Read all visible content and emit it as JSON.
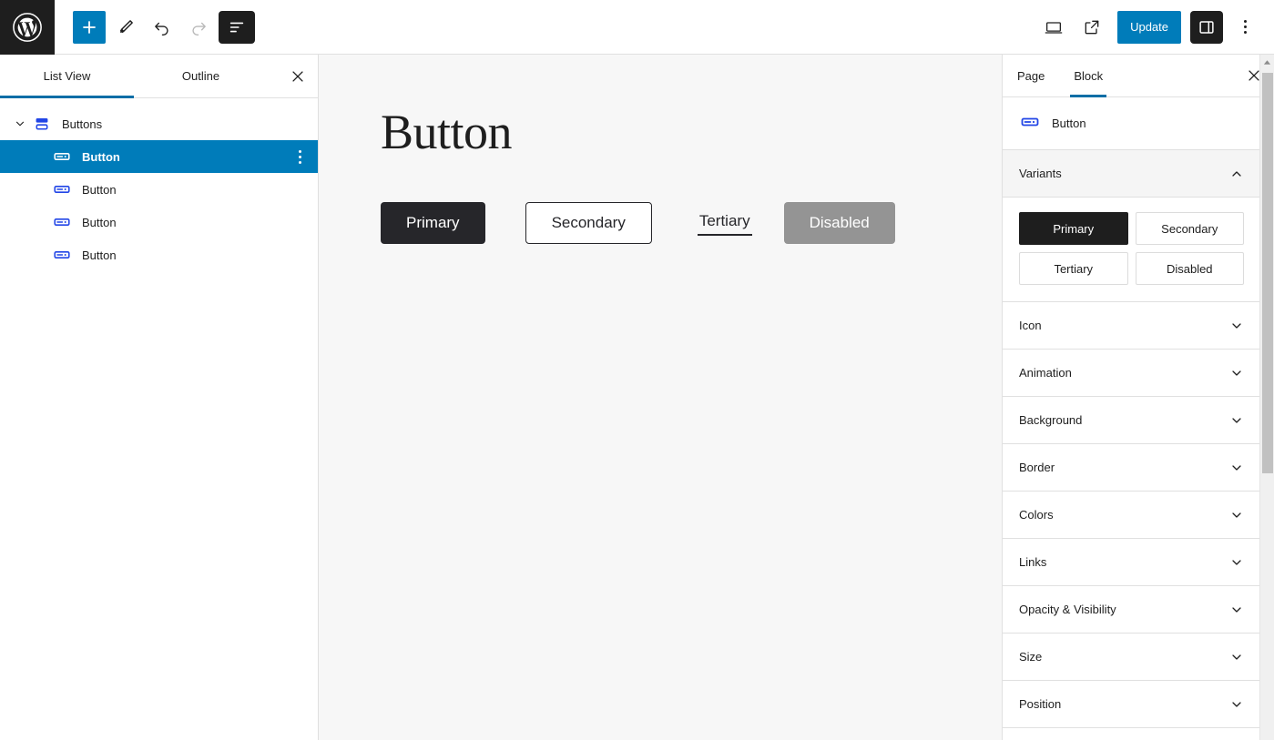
{
  "toolbar": {
    "logo_icon": "wordpress-logo-icon",
    "left_tools": [
      {
        "name": "add-block-button",
        "icon": "plus-icon",
        "label": "Add block",
        "state": "primary"
      },
      {
        "name": "edit-tool-button",
        "icon": "pencil-icon",
        "label": "Edit",
        "state": "default"
      },
      {
        "name": "undo-button",
        "icon": "undo-arrow-icon",
        "label": "Undo",
        "state": "default"
      },
      {
        "name": "redo-button",
        "icon": "redo-arrow-icon",
        "label": "Redo",
        "state": "disabled"
      },
      {
        "name": "list-view-button",
        "icon": "document-overview-icon",
        "label": "Document Overview",
        "state": "active"
      }
    ],
    "right_tools": [
      {
        "name": "preview-button",
        "icon": "desktop-icon",
        "label": "Preview"
      },
      {
        "name": "view-site-button",
        "icon": "external-link-icon",
        "label": "View site"
      }
    ],
    "update_label": "Update",
    "sidebar_toggle": {
      "name": "settings-toggle-button",
      "icon": "sidebar-panel-icon",
      "label": "Settings",
      "state": "active"
    },
    "more_options": {
      "name": "more-options-button",
      "icon": "vertical-dots-icon",
      "label": "Options"
    },
    "accent_color": "#007cba",
    "dark_color": "#1e1e1e"
  },
  "list_view": {
    "tabs": [
      {
        "label": "List View",
        "active": true
      },
      {
        "label": "Outline",
        "active": false
      }
    ],
    "close_label": "Close",
    "tree": [
      {
        "label": "Buttons",
        "icon": "buttons-group-icon",
        "depth": 0,
        "expanded": true,
        "selected": false
      },
      {
        "label": "Button",
        "icon": "button-block-icon",
        "depth": 1,
        "expanded": false,
        "selected": true
      },
      {
        "label": "Button",
        "icon": "button-block-icon",
        "depth": 1,
        "expanded": false,
        "selected": false
      },
      {
        "label": "Button",
        "icon": "button-block-icon",
        "depth": 1,
        "expanded": false,
        "selected": false
      },
      {
        "label": "Button",
        "icon": "button-block-icon",
        "depth": 1,
        "expanded": false,
        "selected": false
      }
    ],
    "selected_color": "#007cba",
    "tab_underline_color": "#0a6ea6"
  },
  "canvas": {
    "background": "#f7f7f7",
    "title": "Button",
    "buttons": [
      {
        "label": "Primary",
        "style": "primary",
        "bg": "#26262a",
        "fg": "#ffffff"
      },
      {
        "label": "Secondary",
        "style": "secondary",
        "bg": "#ffffff",
        "fg": "#26262a"
      },
      {
        "label": "Tertiary",
        "style": "tertiary",
        "bg": "transparent",
        "fg": "#26262a"
      },
      {
        "label": "Disabled",
        "style": "disabled",
        "bg": "#949494",
        "fg": "#ffffff"
      }
    ],
    "appender": {
      "name": "block-appender-button",
      "icon": "plus-icon",
      "label": "Add block"
    }
  },
  "settings": {
    "tabs": [
      {
        "label": "Page",
        "active": false
      },
      {
        "label": "Block",
        "active": true
      }
    ],
    "close_label": "Close Settings",
    "block": {
      "name": "Button",
      "icon": "button-block-icon"
    },
    "variants_panel": {
      "title": "Variants",
      "expanded": true,
      "options": [
        {
          "label": "Primary",
          "active": true
        },
        {
          "label": "Secondary",
          "active": false
        },
        {
          "label": "Tertiary",
          "active": false
        },
        {
          "label": "Disabled",
          "active": false
        }
      ]
    },
    "panels": [
      {
        "title": "Icon",
        "expanded": false
      },
      {
        "title": "Animation",
        "expanded": false
      },
      {
        "title": "Background",
        "expanded": false
      },
      {
        "title": "Border",
        "expanded": false
      },
      {
        "title": "Colors",
        "expanded": false
      },
      {
        "title": "Links",
        "expanded": false
      },
      {
        "title": "Opacity & Visibility",
        "expanded": false
      },
      {
        "title": "Size",
        "expanded": false
      },
      {
        "title": "Position",
        "expanded": false
      }
    ],
    "tab_underline_color": "#0a6ea6"
  }
}
